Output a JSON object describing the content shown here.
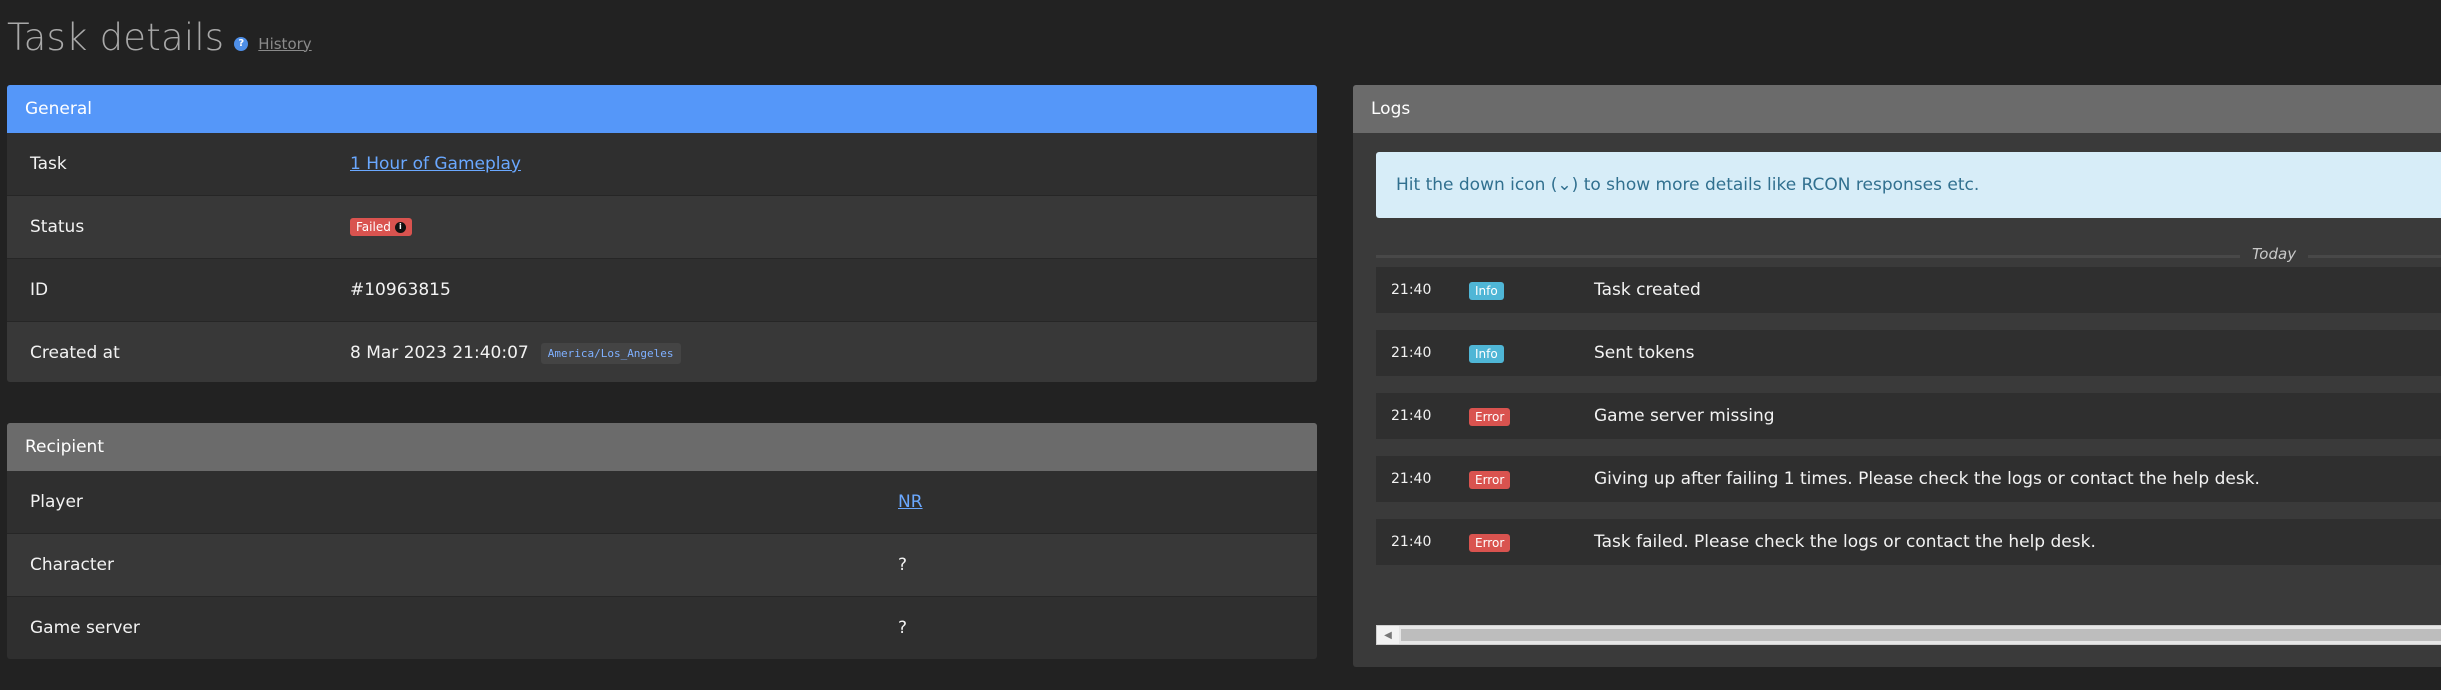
{
  "page": {
    "title": "Task details",
    "help_icon": "?",
    "history_link": "History"
  },
  "general": {
    "header": "General",
    "rows": [
      {
        "label": "Task",
        "value": "1 Hour of Gameplay"
      },
      {
        "label": "Status",
        "value": "Failed"
      },
      {
        "label": "ID",
        "value": "#10963815"
      },
      {
        "label": "Created at",
        "value": "8 Mar 2023 21:40:07",
        "timezone": "America/Los_Angeles"
      }
    ]
  },
  "recipient": {
    "header": "Recipient",
    "rows": [
      {
        "label": "Player",
        "value": "NR"
      },
      {
        "label": "Character",
        "value": "?"
      },
      {
        "label": "Game server",
        "value": "?"
      }
    ]
  },
  "logs": {
    "header": "Logs",
    "alert": "Hit the down icon (⌄) to show more details like RCON responses etc.",
    "divider": "Today",
    "entries": [
      {
        "time": "21:40",
        "level": "Info",
        "message": "Task created"
      },
      {
        "time": "21:40",
        "level": "Info",
        "message": "Sent tokens"
      },
      {
        "time": "21:40",
        "level": "Error",
        "message": "Game server missing"
      },
      {
        "time": "21:40",
        "level": "Error",
        "message": "Giving up after failing 1 times. Please check the logs or contact the help desk."
      },
      {
        "time": "21:40",
        "level": "Error",
        "message": "Task failed. Please check the logs or contact the help desk."
      }
    ]
  },
  "colors": {
    "primary_header": "#5597f9",
    "error": "#d9534f",
    "info": "#4fb6d6",
    "link": "#6aa8ff"
  },
  "icons": {
    "help": "question-circle-icon",
    "status_info": "info-circle-icon",
    "scroll_left": "chevron-left-icon"
  }
}
